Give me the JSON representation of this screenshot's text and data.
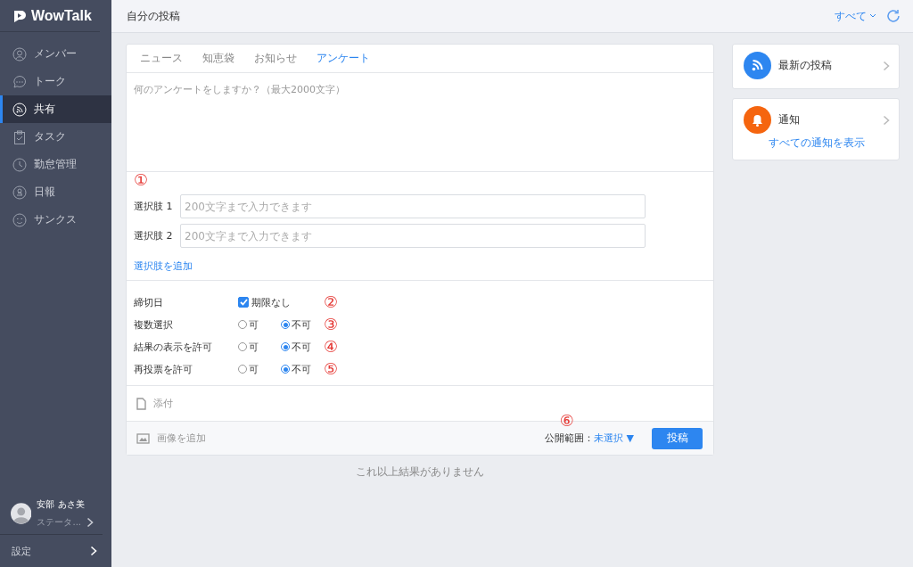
{
  "sidebar": {
    "logo": "WowTalk",
    "items": [
      {
        "label": "メンバー",
        "selected": false
      },
      {
        "label": "トーク",
        "selected": false
      },
      {
        "label": "共有",
        "selected": true
      },
      {
        "label": "タスク",
        "selected": false
      },
      {
        "label": "勤怠管理",
        "selected": false
      },
      {
        "label": "日報",
        "selected": false
      },
      {
        "label": "サンクス",
        "selected": false
      }
    ],
    "user": {
      "name": "安部 あさ美",
      "status": "ステータ..."
    },
    "settings": "設定"
  },
  "header": {
    "title": "自分の投稿",
    "filter": "すべて"
  },
  "composer": {
    "tabs": [
      {
        "label": "ニュース",
        "selected": false
      },
      {
        "label": "知恵袋",
        "selected": false
      },
      {
        "label": "お知らせ",
        "selected": false
      },
      {
        "label": "アンケート",
        "selected": true
      }
    ],
    "question_placeholder": "何のアンケートをしますか？（最大2000文字）",
    "choices_marker": "①",
    "choices": [
      {
        "label": "選択肢 1",
        "placeholder": "200文字まで入力できます"
      },
      {
        "label": "選択肢 2",
        "placeholder": "200文字まで入力できます"
      }
    ],
    "add_choice": "選択肢を追加",
    "options": [
      {
        "kind": "checkbox",
        "label": "締切日",
        "text": "期限なし",
        "checked": true,
        "marker": "②"
      },
      {
        "kind": "radio",
        "label": "複数選択",
        "choices": [
          {
            "text": "可",
            "selected": false
          },
          {
            "text": "不可",
            "selected": true
          }
        ],
        "marker": "③"
      },
      {
        "kind": "radio",
        "label": "結果の表示を許可",
        "choices": [
          {
            "text": "可",
            "selected": false
          },
          {
            "text": "不可",
            "selected": true
          }
        ],
        "marker": "④"
      },
      {
        "kind": "radio",
        "label": "再投票を許可",
        "choices": [
          {
            "text": "可",
            "selected": false
          },
          {
            "text": "不可",
            "selected": true
          }
        ],
        "marker": "⑤"
      }
    ],
    "attach": "添付",
    "add_image": "画像を追加",
    "scope_marker": "⑥",
    "scope_label": "公開範囲：",
    "scope_value": "未選択",
    "scope_caret": "▼",
    "submit": "投稿"
  },
  "no_more": "これ以上結果がありません",
  "right_panel": {
    "latest": "最新の投稿",
    "notice": "通知",
    "notice_link": "すべての通知を表示"
  }
}
